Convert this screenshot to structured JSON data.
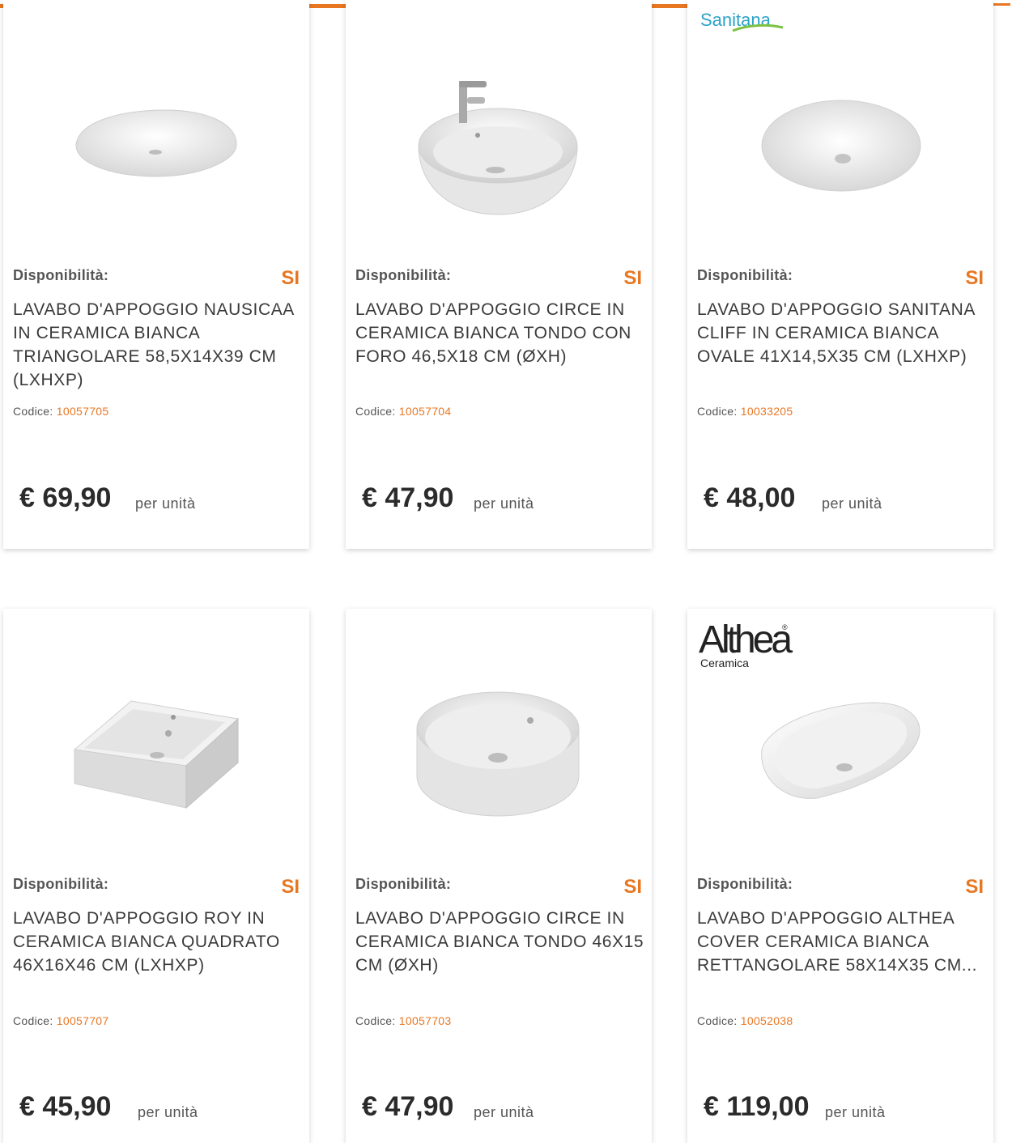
{
  "products": [
    {
      "availability_label": "Disponibilità:",
      "availability_value": "SI",
      "title": "LAVABO D'APPOGGIO NAUSICAA IN CERAMICA BIANCA TRIANGOLARE 58,5X14X39 CM (LXHXP)",
      "code_label": "Codice:",
      "code": "10057705",
      "price": "€ 69,90",
      "unit": "per unità",
      "image": "oval-vessel-sink",
      "brand": ""
    },
    {
      "availability_label": "Disponibilità:",
      "availability_value": "SI",
      "title": "LAVABO D'APPOGGIO CIRCE IN CERAMICA BIANCA TONDO CON FORO 46,5X18 CM (ØXH)",
      "code_label": "Codice:",
      "code": "10057704",
      "price": "€ 47,90",
      "unit": "per unità",
      "image": "round-sink-with-faucet",
      "brand": ""
    },
    {
      "availability_label": "Disponibilità:",
      "availability_value": "SI",
      "title": "LAVABO D'APPOGGIO SANITANA CLIFF IN CERAMICA BIANCA OVALE 41X14,5X35 CM (LXHXP)",
      "code_label": "Codice:",
      "code": "10033205",
      "price": "€ 48,00",
      "unit": "per unità",
      "image": "oval-basin",
      "brand": "Sanitana"
    },
    {
      "availability_label": "Disponibilità:",
      "availability_value": "SI",
      "title": "LAVABO D'APPOGGIO ROY IN CERAMICA BIANCA QUADRATO 46X16X46 CM (LXHXP)",
      "code_label": "Codice:",
      "code": "10057707",
      "price": "€ 45,90",
      "unit": "per unità",
      "image": "square-sink",
      "brand": ""
    },
    {
      "availability_label": "Disponibilità:",
      "availability_value": "SI",
      "title": "LAVABO D'APPOGGIO CIRCE IN CERAMICA BIANCA TONDO 46X15 CM (ØXH)",
      "code_label": "Codice:",
      "code": "10057703",
      "price": "€ 47,90",
      "unit": "per unità",
      "image": "round-bowl-sink",
      "brand": ""
    },
    {
      "availability_label": "Disponibilità:",
      "availability_value": "SI",
      "title": "LAVABO D'APPOGGIO ALTHEA COVER CERAMICA BIANCA RETTANGOLARE 58X14X35 CM...",
      "code_label": "Codice:",
      "code": "10052038",
      "price": "€ 119,00",
      "unit": "per unità",
      "image": "rectangular-sink",
      "brand": "Althea Ceramica"
    }
  ],
  "colors": {
    "accent": "#e87722",
    "text": "#3a3a3a"
  }
}
